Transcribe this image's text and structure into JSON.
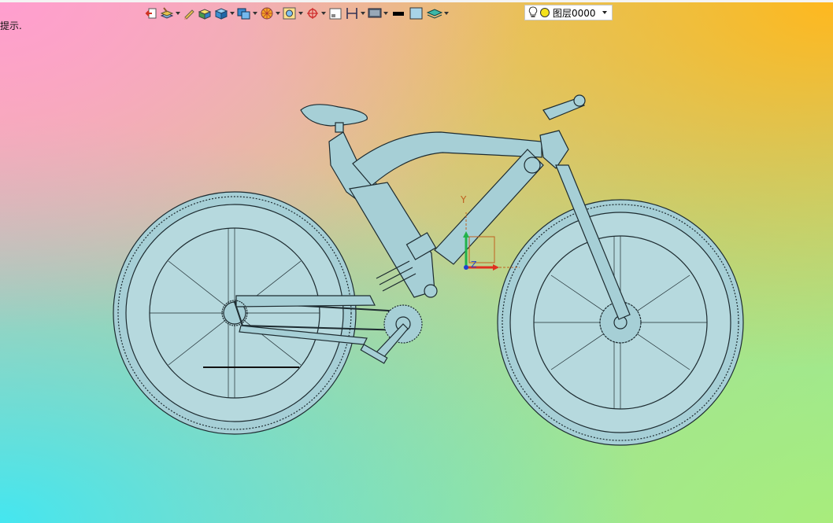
{
  "status": {
    "hint": "提示."
  },
  "toolbar": {
    "items": [
      {
        "name": "exit-icon",
        "dropdown": false
      },
      {
        "name": "layer-stack-icon",
        "dropdown": true
      },
      {
        "name": "pencil-icon",
        "dropdown": false
      },
      {
        "name": "solid-color-icon",
        "dropdown": false
      },
      {
        "name": "cube-icon",
        "dropdown": true
      },
      {
        "name": "display-mode-icon",
        "dropdown": true
      },
      {
        "name": "render-style-icon",
        "dropdown": true
      },
      {
        "name": "zoom-fit-icon",
        "dropdown": true
      },
      {
        "name": "view-center-icon",
        "dropdown": true
      },
      {
        "name": "window-icon",
        "dropdown": false
      },
      {
        "name": "bracket-icon",
        "dropdown": true
      },
      {
        "name": "monitor-icon",
        "dropdown": true
      },
      {
        "name": "line-color-icon",
        "dropdown": false
      },
      {
        "name": "fill-color-icon",
        "dropdown": false
      },
      {
        "name": "layers-icon",
        "dropdown": true
      }
    ],
    "layer": {
      "label": "图层0000"
    }
  },
  "axes": {
    "x": "X",
    "y": "Y",
    "z": "Z"
  },
  "colors": {
    "model": "#a6cfd6",
    "edge": "#1d2b30",
    "axis_x": "#e03020",
    "axis_y": "#22b34a",
    "axis_z": "#2040d0",
    "axis_box": "#c06020"
  }
}
